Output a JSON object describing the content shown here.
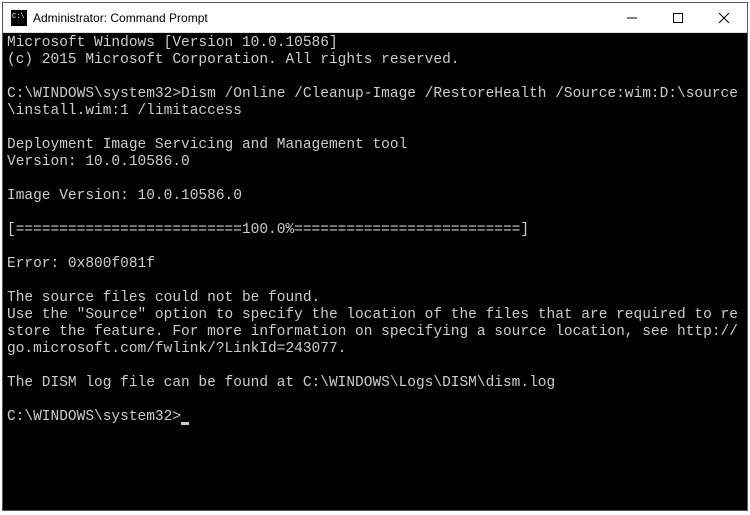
{
  "window": {
    "title": "Administrator: Command Prompt"
  },
  "terminal": {
    "line1": "Microsoft Windows [Version 10.0.10586]",
    "line2": "(c) 2015 Microsoft Corporation. All rights reserved.",
    "blank1": "",
    "prompt1": "C:\\WINDOWS\\system32>",
    "command1": "Dism /Online /Cleanup-Image /RestoreHealth /Source:wim:D:\\source\\install.wim:1 /limitaccess",
    "blank2": "",
    "tool_line": "Deployment Image Servicing and Management tool",
    "version_line": "Version: 10.0.10586.0",
    "blank3": "",
    "image_version": "Image Version: 10.0.10586.0",
    "blank4": "",
    "progress": "[==========================100.0%==========================]",
    "blank5": "",
    "error": "Error: 0x800f081f",
    "blank6": "",
    "msg1": "The source files could not be found.",
    "msg2": "Use the \"Source\" option to specify the location of the files that are required to restore the feature. For more information on specifying a source location, see http://go.microsoft.com/fwlink/?LinkId=243077.",
    "blank7": "",
    "logmsg": "The DISM log file can be found at C:\\WINDOWS\\Logs\\DISM\\dism.log",
    "blank8": "",
    "prompt2": "C:\\WINDOWS\\system32>"
  }
}
